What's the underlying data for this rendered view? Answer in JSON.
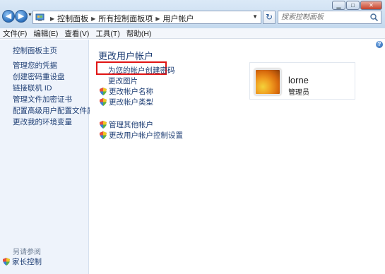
{
  "window": {
    "title_caption": "用户帐户",
    "caption_buttons": [
      "minimize-icon",
      "maximize-icon",
      "close-icon"
    ]
  },
  "address": {
    "crumbs": [
      "控制面板",
      "所有控制面板项",
      "用户帐户"
    ],
    "search_placeholder": "搜索控制面板"
  },
  "menu": {
    "items": [
      "文件(F)",
      "编辑(E)",
      "查看(V)",
      "工具(T)",
      "帮助(H)"
    ]
  },
  "sidebar": {
    "home": "控制面板主页",
    "items": [
      "管理您的凭据",
      "创建密码重设盘",
      "链接联机 ID",
      "管理文件加密证书",
      "配置高级用户配置文件属性",
      "更改我的环境变量"
    ],
    "see_also": "另请参阅",
    "parental": "家长控制"
  },
  "main": {
    "heading": "更改用户帐户",
    "tasks": [
      "为您的帐户创建密码",
      "更改图片",
      "更改帐户名称",
      "更改帐户类型"
    ],
    "other_tasks": [
      "管理其他帐户",
      "更改用户帐户控制设置"
    ],
    "highlighted_task_index": 0
  },
  "account": {
    "name": "lorne",
    "role": "管理员"
  },
  "colors": {
    "link": "#1e3e74",
    "highlight": "#e01414",
    "sidebar_bg": "#eef3fb"
  }
}
